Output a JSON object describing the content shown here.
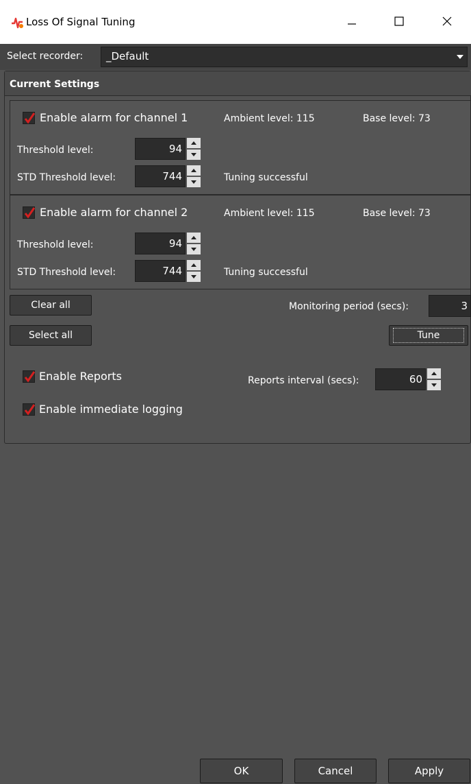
{
  "window": {
    "title": "Loss Of Signal Tuning",
    "icon": "signal-app-icon",
    "controls": [
      "minimize-icon",
      "maximize-icon",
      "close-icon"
    ]
  },
  "recorder": {
    "label": "Select recorder:",
    "value": "_Default"
  },
  "settings": {
    "title": "Current Settings"
  },
  "channels": [
    {
      "enable_label": "Enable alarm for channel 1",
      "checked": true,
      "ambient": "Ambient level: 115",
      "base": "Base level: 73",
      "threshold_label": "Threshold level:",
      "threshold_value": "94",
      "std_label": "STD Threshold level:",
      "std_value": "744",
      "status": "Tuning successful"
    },
    {
      "enable_label": "Enable alarm for channel 2",
      "checked": true,
      "ambient": "Ambient level: 115",
      "base": "Base level: 73",
      "threshold_label": "Threshold level:",
      "threshold_value": "94",
      "std_label": "STD Threshold level:",
      "std_value": "744",
      "status": "Tuning successful"
    }
  ],
  "actions": {
    "clear_all": "Clear all",
    "select_all": "Select all",
    "monitoring_label": "Monitoring period (secs):",
    "monitoring_value": "3",
    "tune": "Tune"
  },
  "reports": {
    "enable_reports": "Enable Reports",
    "enable_reports_checked": true,
    "enable_logging": "Enable immediate logging",
    "enable_logging_checked": true,
    "interval_label": "Reports interval (secs):",
    "interval_value": "60"
  },
  "footer": {
    "ok": "OK",
    "cancel": "Cancel",
    "apply": "Apply"
  },
  "colors": {
    "background": "#525252",
    "checkmark": "#d42020",
    "titlebar": "#ffffff"
  }
}
